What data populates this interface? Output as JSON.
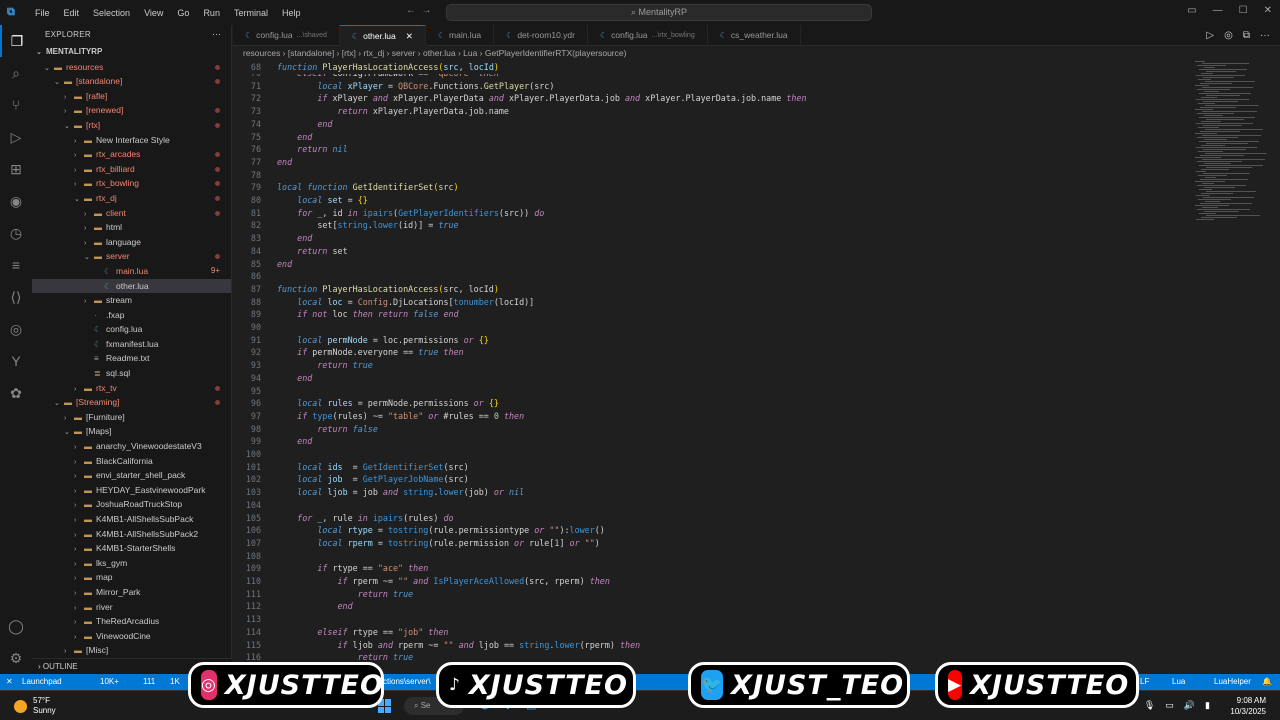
{
  "menu": [
    "File",
    "Edit",
    "Selection",
    "View",
    "Go",
    "Run",
    "Terminal",
    "Help"
  ],
  "command_center": "MentalityRP",
  "sidebar": {
    "header": "EXPLORER",
    "root": "MENTALITYRP",
    "outline": "OUTLINE",
    "items": [
      {
        "label": "resources",
        "depth": 0,
        "type": "folder",
        "open": true,
        "red": true,
        "dot": true
      },
      {
        "label": "[standalone]",
        "depth": 1,
        "type": "folder",
        "open": true,
        "red": true,
        "dot": true
      },
      {
        "label": "[rafle]",
        "depth": 2,
        "type": "folder",
        "open": false,
        "red": true
      },
      {
        "label": "[renewed]",
        "depth": 2,
        "type": "folder",
        "open": false,
        "red": true,
        "dot": true
      },
      {
        "label": "[rtx]",
        "depth": 2,
        "type": "folder",
        "open": true,
        "red": true,
        "dot": true
      },
      {
        "label": "New Interface Style",
        "depth": 3,
        "type": "folder",
        "open": false
      },
      {
        "label": "rtx_arcades",
        "depth": 3,
        "type": "folder",
        "open": false,
        "red": true,
        "dot": true
      },
      {
        "label": "rtx_billiard",
        "depth": 3,
        "type": "folder",
        "open": false,
        "red": true,
        "dot": true
      },
      {
        "label": "rtx_bowling",
        "depth": 3,
        "type": "folder",
        "open": false,
        "red": true,
        "dot": true
      },
      {
        "label": "rtx_dj",
        "depth": 3,
        "type": "folder",
        "open": true,
        "red": true,
        "dot": true
      },
      {
        "label": "client",
        "depth": 4,
        "type": "folder",
        "open": false,
        "red": true,
        "dot": true
      },
      {
        "label": "html",
        "depth": 4,
        "type": "folder",
        "open": false
      },
      {
        "label": "language",
        "depth": 4,
        "type": "folder",
        "open": false
      },
      {
        "label": "server",
        "depth": 4,
        "type": "folder",
        "open": true,
        "red": true,
        "dot": true
      },
      {
        "label": "main.lua",
        "depth": 5,
        "type": "lua",
        "red": true,
        "count": "9+"
      },
      {
        "label": "other.lua",
        "depth": 5,
        "type": "lua",
        "selected": true
      },
      {
        "label": "stream",
        "depth": 4,
        "type": "folder",
        "open": false
      },
      {
        "label": ".fxap",
        "depth": 4,
        "type": "file"
      },
      {
        "label": "config.lua",
        "depth": 4,
        "type": "lua"
      },
      {
        "label": "fxmanifest.lua",
        "depth": 4,
        "type": "lua"
      },
      {
        "label": "Readme.txt",
        "depth": 4,
        "type": "txt"
      },
      {
        "label": "sql.sql",
        "depth": 4,
        "type": "sql"
      },
      {
        "label": "rtx_tv",
        "depth": 3,
        "type": "folder",
        "open": false,
        "red": true,
        "dot": true
      },
      {
        "label": "[Streaming]",
        "depth": 1,
        "type": "folder",
        "open": true,
        "red": true,
        "dot": true
      },
      {
        "label": "[Furniture]",
        "depth": 2,
        "type": "folder",
        "open": false
      },
      {
        "label": "[Maps]",
        "depth": 2,
        "type": "folder",
        "open": true
      },
      {
        "label": "anarchy_VinewoodestateV3",
        "depth": 3,
        "type": "folder",
        "open": false
      },
      {
        "label": "BlackCalifornia",
        "depth": 3,
        "type": "folder",
        "open": false
      },
      {
        "label": "envi_starter_shell_pack",
        "depth": 3,
        "type": "folder",
        "open": false
      },
      {
        "label": "HEYDAY_EastvinewoodPark",
        "depth": 3,
        "type": "folder",
        "open": false
      },
      {
        "label": "JoshuaRoadTruckStop",
        "depth": 3,
        "type": "folder",
        "open": false
      },
      {
        "label": "K4MB1-AllShellsSubPack",
        "depth": 3,
        "type": "folder",
        "open": false
      },
      {
        "label": "K4MB1-AllShellsSubPack2",
        "depth": 3,
        "type": "folder",
        "open": false
      },
      {
        "label": "K4MB1-StarterShells",
        "depth": 3,
        "type": "folder",
        "open": false
      },
      {
        "label": "lks_gym",
        "depth": 3,
        "type": "folder",
        "open": false
      },
      {
        "label": "map",
        "depth": 3,
        "type": "folder",
        "open": false
      },
      {
        "label": "Mirror_Park",
        "depth": 3,
        "type": "folder",
        "open": false
      },
      {
        "label": "river",
        "depth": 3,
        "type": "folder",
        "open": false
      },
      {
        "label": "TheRedArcadius",
        "depth": 3,
        "type": "folder",
        "open": false
      },
      {
        "label": "VinewoodCine",
        "depth": 3,
        "type": "folder",
        "open": false
      },
      {
        "label": "[Misc]",
        "depth": 2,
        "type": "folder",
        "open": false
      }
    ]
  },
  "tabs": [
    {
      "label": "config.lua",
      "sub": "...\\shaved",
      "active": false
    },
    {
      "label": "other.lua",
      "sub": "",
      "active": true
    },
    {
      "label": "main.lua",
      "sub": "",
      "active": false
    },
    {
      "label": "det-room10.ydr",
      "sub": "",
      "active": false
    },
    {
      "label": "config.lua",
      "sub": "...\\rtx_bowling",
      "active": false
    },
    {
      "label": "cs_weather.lua",
      "sub": "",
      "active": false
    }
  ],
  "breadcrumbs": "resources › [standalone] › [rtx] › rtx_dj › server › other.lua › Lua › GetPlayerIdentifierRTX(playersource)",
  "sticky_line": {
    "num": "68",
    "html": "<span class=\"kw\">function</span> <span class=\"f\">PlayerHasLocationAccess</span><span class=\"b\">(</span><span class=\"v\">src</span>, <span class=\"v\">locId</span><span class=\"b\">)</span>"
  },
  "code_lines": [
    {
      "num": "70",
      "html": "    <span class=\"k\">elseif</span> Config.Framework == <span class=\"s\">\"qbcore\"</span> <span class=\"k\">then</span>"
    },
    {
      "num": "71",
      "html": "        <span class=\"kw\">local</span> <span class=\"v\">xPlayer</span> = <span class=\"s\">QBCore</span>.Functions.<span class=\"f\">GetPlayer</span>(src)"
    },
    {
      "num": "72",
      "html": "        <span class=\"k\">if</span> xPlayer <span class=\"k\">and</span> xPlayer.PlayerData <span class=\"k\">and</span> xPlayer.PlayerData.job <span class=\"k\">and</span> xPlayer.PlayerData.job.name <span class=\"k\">then</span>"
    },
    {
      "num": "73",
      "html": "            <span class=\"k\">return</span> xPlayer.PlayerData.job.name"
    },
    {
      "num": "74",
      "html": "        <span class=\"k\">end</span>"
    },
    {
      "num": "75",
      "html": "    <span class=\"k\">end</span>"
    },
    {
      "num": "76",
      "html": "    <span class=\"k\">return</span> <span class=\"kw\">nil</span>"
    },
    {
      "num": "77",
      "html": "<span class=\"k\">end</span>"
    },
    {
      "num": "78",
      "html": ""
    },
    {
      "num": "79",
      "html": "<span class=\"kw\">local</span> <span class=\"kw\">function</span> <span class=\"f\">GetIdentifierSet</span><span class=\"b\">(</span>src<span class=\"b\">)</span>"
    },
    {
      "num": "80",
      "html": "    <span class=\"kw\">local</span> <span class=\"v\">set</span> = <span class=\"b\">{}</span>"
    },
    {
      "num": "81",
      "html": "    <span class=\"k\">for</span> _, id <span class=\"k\">in</span> <span class=\"fn\">ipairs</span>(<span class=\"fn\">GetPlayerIdentifiers</span>(src)) <span class=\"k\">do</span>"
    },
    {
      "num": "82",
      "html": "        set[<span class=\"fn\">string</span>.<span class=\"fn\">lower</span>(id)] = <span class=\"kw\">true</span>"
    },
    {
      "num": "83",
      "html": "    <span class=\"k\">end</span>"
    },
    {
      "num": "84",
      "html": "    <span class=\"k\">return</span> set"
    },
    {
      "num": "85",
      "html": "<span class=\"k\">end</span>"
    },
    {
      "num": "86",
      "html": ""
    },
    {
      "num": "87",
      "html": "<span class=\"kw\">function</span> <span class=\"f\">PlayerHasLocationAccess</span><span class=\"b\">(</span>src, locId<span class=\"b\">)</span>"
    },
    {
      "num": "88",
      "html": "    <span class=\"kw\">local</span> <span class=\"v\">loc</span> = <span class=\"s\">Config</span>.DjLocations[<span class=\"fn\">tonumber</span>(locId)]"
    },
    {
      "num": "89",
      "html": "    <span class=\"k\">if not</span> loc <span class=\"k\">then return</span> <span class=\"kw\">false</span> <span class=\"k\">end</span>"
    },
    {
      "num": "90",
      "html": ""
    },
    {
      "num": "91",
      "html": "    <span class=\"kw\">local</span> <span class=\"v\">permNode</span> = loc.permissions <span class=\"k\">or</span> <span class=\"b\">{}</span>"
    },
    {
      "num": "92",
      "html": "    <span class=\"k\">if</span> permNode.everyone == <span class=\"kw\">true</span> <span class=\"k\">then</span>"
    },
    {
      "num": "93",
      "html": "        <span class=\"k\">return</span> <span class=\"kw\">true</span>"
    },
    {
      "num": "94",
      "html": "    <span class=\"k\">end</span>"
    },
    {
      "num": "95",
      "html": ""
    },
    {
      "num": "96",
      "html": "    <span class=\"kw\">local</span> <span class=\"v\">rules</span> = permNode.permissions <span class=\"k\">or</span> <span class=\"b\">{}</span>"
    },
    {
      "num": "97",
      "html": "    <span class=\"k\">if</span> <span class=\"fn\">type</span>(rules) ~= <span class=\"s\">\"table\"</span> <span class=\"k\">or</span> #rules == <span class=\"n\">0</span> <span class=\"k\">then</span>"
    },
    {
      "num": "98",
      "html": "        <span class=\"k\">return</span> <span class=\"kw\">false</span>"
    },
    {
      "num": "99",
      "html": "    <span class=\"k\">end</span>"
    },
    {
      "num": "100",
      "html": ""
    },
    {
      "num": "101",
      "html": "    <span class=\"kw\">local</span> <span class=\"v\">ids</span>  = <span class=\"fn\">GetIdentifierSet</span>(src)"
    },
    {
      "num": "102",
      "html": "    <span class=\"kw\">local</span> <span class=\"v\">job</span>  = <span class=\"fn\">GetPlayerJobName</span>(src)"
    },
    {
      "num": "103",
      "html": "    <span class=\"kw\">local</span> <span class=\"v\">ljob</span> = job <span class=\"k\">and</span> <span class=\"fn\">string</span>.<span class=\"fn\">lower</span>(job) <span class=\"k\">or</span> <span class=\"kw\">nil</span>"
    },
    {
      "num": "104",
      "html": ""
    },
    {
      "num": "105",
      "html": "    <span class=\"k\">for</span> _, rule <span class=\"k\">in</span> <span class=\"fn\">ipairs</span>(rules) <span class=\"k\">do</span>"
    },
    {
      "num": "106",
      "html": "        <span class=\"kw\">local</span> <span class=\"v\">rtype</span> = <span class=\"fn\">tostring</span>(rule.permissiontype <span class=\"k\">or</span> <span class=\"s\">\"\"</span>):<span class=\"fn\">lower</span>()"
    },
    {
      "num": "107",
      "html": "        <span class=\"kw\">local</span> <span class=\"v\">rperm</span> = <span class=\"fn\">tostring</span>(rule.permission <span class=\"k\">or</span> rule[<span class=\"n\">1</span>] <span class=\"k\">or</span> <span class=\"s\">\"\"</span>)"
    },
    {
      "num": "108",
      "html": ""
    },
    {
      "num": "109",
      "html": "        <span class=\"k\">if</span> rtype == <span class=\"s\">\"ace\"</span> <span class=\"k\">then</span>"
    },
    {
      "num": "110",
      "html": "            <span class=\"k\">if</span> rperm ~= <span class=\"s\">\"\"</span> <span class=\"k\">and</span> <span class=\"fn\">IsPlayerAceAllowed</span>(src, rperm) <span class=\"k\">then</span>"
    },
    {
      "num": "111",
      "html": "                <span class=\"k\">return</span> <span class=\"kw\">true</span>"
    },
    {
      "num": "112",
      "html": "            <span class=\"k\">end</span>"
    },
    {
      "num": "113",
      "html": ""
    },
    {
      "num": "114",
      "html": "        <span class=\"k\">elseif</span> rtype == <span class=\"s\">\"job\"</span> <span class=\"k\">then</span>"
    },
    {
      "num": "115",
      "html": "            <span class=\"k\">if</span> ljob <span class=\"k\">and</span> rperm ~= <span class=\"s\">\"\"</span> <span class=\"k\">and</span> ljob == <span class=\"fn\">string</span>.<span class=\"fn\">lower</span>(rperm) <span class=\"k\">then</span>"
    },
    {
      "num": "116",
      "html": "                <span class=\"k\">return</span> <span class=\"kw\">true</span>"
    }
  ],
  "statusbar": {
    "left": [
      "Launchpad",
      "10K+",
      "111",
      "1K"
    ],
    "path": "ctions\\server\\",
    "right": [
      "LF",
      "Lua",
      "LuaHelper"
    ]
  },
  "banners": [
    {
      "icon": "instagram-icon",
      "glyph": "◎",
      "text": "XJUSTTEO",
      "bg": "#e1306c"
    },
    {
      "icon": "tiktok-icon",
      "glyph": "♪",
      "text": "XJUSTTEO",
      "bg": "#000000"
    },
    {
      "icon": "twitter-icon",
      "glyph": "🐦",
      "text": "XJUST_TEO",
      "bg": "#1da1f2"
    },
    {
      "icon": "youtube-icon",
      "glyph": "▶",
      "text": "XJUSTTEO",
      "bg": "#ff0000"
    }
  ],
  "taskbar": {
    "temp": "57°F",
    "condition": "Sunny",
    "search": "Se",
    "time": "9:08 AM",
    "date": "10/3/2025"
  }
}
